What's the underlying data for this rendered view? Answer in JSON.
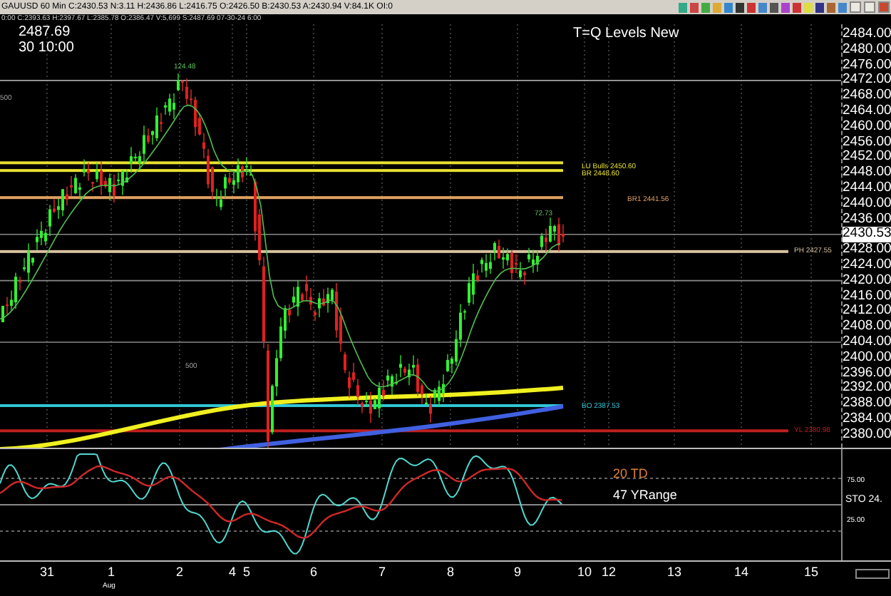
{
  "header": {
    "quote_line": "GAUUSD 60 Min  C:2430.53  N:3.11  H:2436.86  L:2416.75  O:2426.50  B:2430.53  A:2430.94  V:84.1K  OI:0",
    "bar_line": "0:00  C:2393.63  H:2397.67  L:2385.78  O:2386.47  V:5,699  S:2487.69  07-30-24  6:00"
  },
  "cursor": {
    "price": "2487.69",
    "time": "30 10:00"
  },
  "title": "T=Q Levels New",
  "price_axis": [
    {
      "text": "2484.00",
      "current": false
    },
    {
      "text": "2480.00",
      "current": false
    },
    {
      "text": "2476.00",
      "current": false
    },
    {
      "text": "2472.00",
      "current": false
    },
    {
      "text": "2468.00",
      "current": false
    },
    {
      "text": "2464.00",
      "current": false
    },
    {
      "text": "2460.00",
      "current": false
    },
    {
      "text": "2456.00",
      "current": false
    },
    {
      "text": "2452.00",
      "current": false
    },
    {
      "text": "2448.00",
      "current": false
    },
    {
      "text": "2444.00",
      "current": false
    },
    {
      "text": "2440.00",
      "current": false
    },
    {
      "text": "2436.00",
      "current": false
    },
    {
      "text": "2430.53",
      "current": true
    },
    {
      "text": "2428.00",
      "current": false
    },
    {
      "text": "2424.00",
      "current": false
    },
    {
      "text": "2420.00",
      "current": false
    },
    {
      "text": "2416.00",
      "current": false
    },
    {
      "text": "2412.00",
      "current": false
    },
    {
      "text": "2408.00",
      "current": false
    },
    {
      "text": "2404.00",
      "current": false
    },
    {
      "text": "2400.00",
      "current": false
    },
    {
      "text": "2396.00",
      "current": false
    },
    {
      "text": "2392.00",
      "current": false
    },
    {
      "text": "2388.00",
      "current": false
    },
    {
      "text": "2384.00",
      "current": false
    },
    {
      "text": "2380.00",
      "current": false
    }
  ],
  "annotations": [
    "124.48",
    "72.73",
    "500",
    "500"
  ],
  "levels": [
    {
      "label": "LU Bulls 2450.60",
      "color": "#e8e030"
    },
    {
      "label": "BR 2448.60",
      "color": "#e8e030"
    },
    {
      "label": "BR1 2441.56",
      "color": "#e0a060"
    },
    {
      "label": "PH 2427.55",
      "color": "#d8c0a0"
    },
    {
      "label": "BO 2387.53",
      "color": "#30c8d8"
    },
    {
      "label": "YL 2380.98",
      "color": "#c02020"
    }
  ],
  "oscillator": {
    "legend": [
      {
        "text": "20 TD",
        "color": "#e08030"
      },
      {
        "text": "47 YRange",
        "color": "#ffffff"
      }
    ],
    "label": "STO 24.",
    "ticks": [
      "75.00",
      "25.00"
    ]
  },
  "date_axis": {
    "labels": [
      "31",
      "1",
      "2",
      "4",
      "5",
      "6",
      "7",
      "8",
      "9",
      "10",
      "12",
      "13",
      "14",
      "15"
    ],
    "month": "Aug"
  }
}
